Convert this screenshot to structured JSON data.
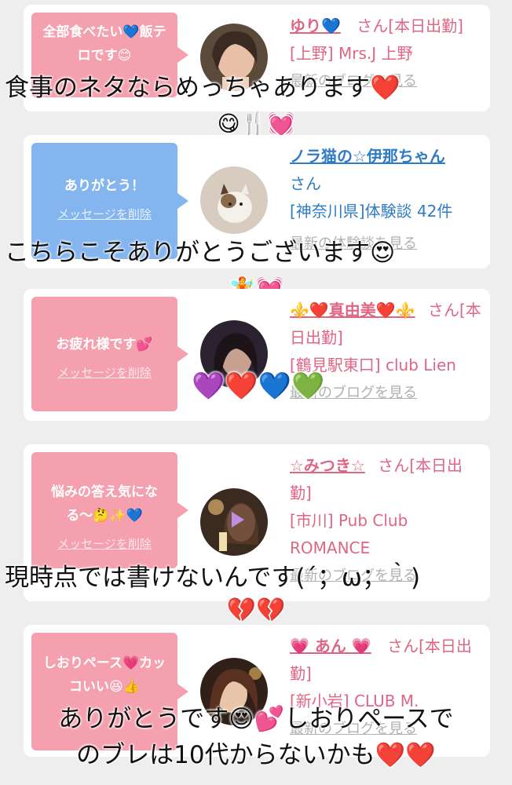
{
  "cards": [
    {
      "message": "全部食べたい💙飯テロです😊",
      "delete_label": "",
      "user_name": "ゆり💙",
      "san": "さん[本日出勤]",
      "shop": "[上野] Mrs.J 上野",
      "blog_link": "最新のブログを見る",
      "caption": "食事のネタならめっちゃあります❤️",
      "caption_emoji": "😋🍴💓"
    },
    {
      "message": "ありがとう！",
      "delete_label": "メッセージを削除",
      "user_name": "ノラ猫の☆伊那ちゃん",
      "san": "さん",
      "shop": "[神奈川県]体験談 42件",
      "blog_link": "最新の体験談を見る",
      "caption": "こちらこそありがとうございます😍",
      "caption_emoji": "🧚💓"
    },
    {
      "message": "お疲れ様です💕",
      "delete_label": "メッセージを削除",
      "user_name": "⚜️❤️真由美❤️⚜️",
      "san": "さん[本日出勤]",
      "shop": "[鶴見駅東口] club Lien",
      "blog_link": "最新のブログを見る",
      "caption": "",
      "caption_emoji": "💜❤️💙💚"
    },
    {
      "message": "悩みの答え気になる〜🤔✨💙",
      "delete_label": "メッセージを削除",
      "user_name": "☆みつき☆",
      "san": "さん[本日出勤]",
      "shop": "[市川] Pub Club ROMANCE",
      "blog_link": "最新のブログを見る",
      "caption": "現時点では書けないんです(´；ω；｀)",
      "caption_emoji": "💔💔"
    },
    {
      "message": "しおりペース💗カッコいい😆👍",
      "delete_label": "",
      "user_name": "💗 あん 💗",
      "san": "さん[本日出勤]",
      "shop": "[新小岩] CLUB M.",
      "blog_link": "最新のブログを見る",
      "caption": "ありがとうです😍💕しおりペースで",
      "caption_line2": "のブレは10代からないかも❤️❤️"
    }
  ],
  "colors": {
    "pink_bubble": "#f5a0ae",
    "blue_bubble": "#85b5ee",
    "pink_text": "#e06585",
    "blue_text": "#2f7cc4"
  }
}
